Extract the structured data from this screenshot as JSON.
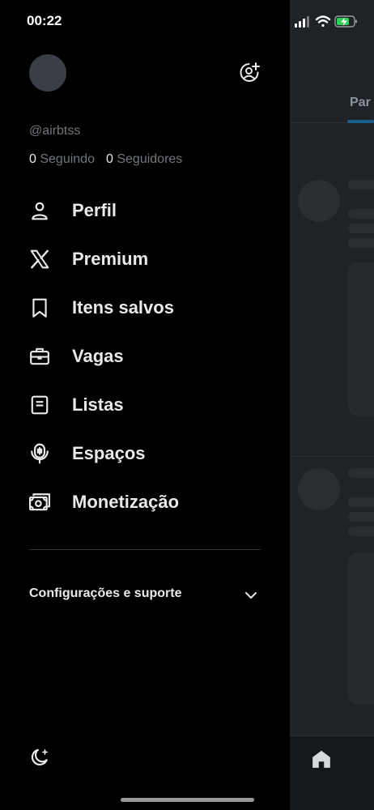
{
  "status": {
    "time": "00:22"
  },
  "profile": {
    "handle": "@airbtss",
    "following_count": "0",
    "following_label": "Seguindo",
    "followers_count": "0",
    "followers_label": "Seguidores"
  },
  "menu": [
    {
      "label": "Perfil",
      "icon": "person-icon"
    },
    {
      "label": "Premium",
      "icon": "x-logo-icon"
    },
    {
      "label": "Itens salvos",
      "icon": "bookmark-icon"
    },
    {
      "label": "Vagas",
      "icon": "briefcase-icon"
    },
    {
      "label": "Listas",
      "icon": "list-icon"
    },
    {
      "label": "Espaços",
      "icon": "spaces-microphone-icon"
    },
    {
      "label": "Monetização",
      "icon": "money-icon"
    }
  ],
  "settings": {
    "label": "Configurações e suporte"
  },
  "background": {
    "tab_label": "Par"
  },
  "colors": {
    "background": "#000000",
    "text": "#e7e9ea",
    "muted": "#71767b",
    "accent": "#1d9bf0"
  }
}
